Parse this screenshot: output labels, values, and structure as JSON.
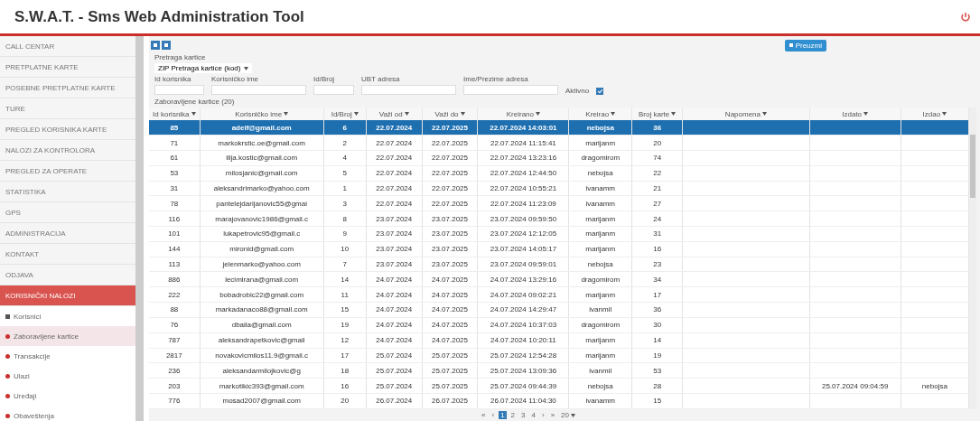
{
  "header": {
    "title": "S.W.A.T. - Sms Web Administration Tool"
  },
  "sidebar": {
    "items": [
      {
        "label": "CALL CENTAR",
        "selected": false
      },
      {
        "label": "PRETPLATNE KARTE",
        "selected": false
      },
      {
        "label": "POSEBNE PRETPLATNE KARTE",
        "selected": false
      },
      {
        "label": "TURE",
        "selected": false
      },
      {
        "label": "PREGLED KORISNIKA KARTE",
        "selected": false
      },
      {
        "label": "NALOZI ZA KONTROLORA",
        "selected": false
      },
      {
        "label": "PREGLED ZA OPERATE",
        "selected": false
      },
      {
        "label": "STATISTIKA",
        "selected": false
      },
      {
        "label": "GPS",
        "selected": false
      },
      {
        "label": "ADMINISTRACIJA",
        "selected": false
      },
      {
        "label": "KONTAKT",
        "selected": false
      },
      {
        "label": "ODJAVA",
        "selected": false
      },
      {
        "label": "KORISNIČKI NALOZI",
        "selected": true,
        "expanded": true,
        "children": [
          {
            "label": "Korisnici",
            "selected": false,
            "kind": "square"
          },
          {
            "label": "Zaboravljene kartice",
            "selected": true,
            "kind": "dot"
          },
          {
            "label": "Transakcije",
            "selected": false,
            "kind": "dot"
          },
          {
            "label": "Ulazi",
            "selected": false,
            "kind": "dot"
          },
          {
            "label": "Uređaji",
            "selected": false,
            "kind": "dot"
          },
          {
            "label": "Obaveštenja",
            "selected": false,
            "kind": "dot"
          }
        ]
      }
    ]
  },
  "toolbar": {
    "export_button": "Preuzmi"
  },
  "filters": {
    "search_label": "Pretraga kartice",
    "search_select": "ZIP Pretraga kartice (kod)",
    "fields": [
      "Id korisnika",
      "Korisničko ime",
      "Id/Broj",
      "UBT adresa",
      "Ime/Prezime adresa"
    ],
    "active": {
      "label": "Aktivno",
      "checked": true
    }
  },
  "table": {
    "caption": "Zaboravljene kartice (20)",
    "columns": [
      "Id korisnika",
      "Korisničko ime",
      "Id/Broj",
      "Važi od",
      "Važi do",
      "Kreirano",
      "Kreirao",
      "Broj karte",
      "Napomena",
      "Izdato",
      "Izdao"
    ],
    "rows": [
      {
        "selected": true,
        "cells": [
          "85",
          "adelf@gmail.com",
          "6",
          "22.07.2024",
          "22.07.2025",
          "22.07.2024 14:03:01",
          "nebojsa",
          "36",
          "",
          "",
          ""
        ]
      },
      {
        "selected": false,
        "cells": [
          "71",
          "markokrstic.oe@gmail.com",
          "2",
          "22.07.2024",
          "22.07.2025",
          "22.07.2024 11:15:41",
          "marijanm",
          "20",
          "",
          "",
          ""
        ]
      },
      {
        "selected": false,
        "cells": [
          "61",
          "ilija.kostic@gmail.com",
          "4",
          "22.07.2024",
          "22.07.2025",
          "22.07.2024 13:23:16",
          "dragomirom",
          "74",
          "",
          "",
          ""
        ]
      },
      {
        "selected": false,
        "cells": [
          "53",
          "milosjanic@gmail.com",
          "5",
          "22.07.2024",
          "22.07.2025",
          "22.07.2024 12:44:50",
          "nebojsa",
          "22",
          "",
          "",
          ""
        ]
      },
      {
        "selected": false,
        "cells": [
          "31",
          "aleksandrimarko@yahoo.com",
          "1",
          "22.07.2024",
          "22.07.2025",
          "22.07.2024 10:55:21",
          "ivanamm",
          "21",
          "",
          "",
          ""
        ]
      },
      {
        "selected": false,
        "cells": [
          "78",
          "pantelejdarijanovic55@gmai",
          "3",
          "22.07.2024",
          "22.07.2025",
          "22.07.2024 11:23:09",
          "ivanamm",
          "27",
          "",
          "",
          ""
        ]
      },
      {
        "selected": false,
        "cells": [
          "116",
          "marajovanovic1986@gmail.c",
          "8",
          "23.07.2024",
          "23.07.2025",
          "23.07.2024 09:59:50",
          "marijanm",
          "24",
          "",
          "",
          ""
        ]
      },
      {
        "selected": false,
        "cells": [
          "101",
          "lukapetrovic95@gmail.c",
          "9",
          "23.07.2024",
          "23.07.2025",
          "23.07.2024 12:12:05",
          "marijanm",
          "31",
          "",
          "",
          ""
        ]
      },
      {
        "selected": false,
        "cells": [
          "144",
          "mironid@gmail.com",
          "10",
          "23.07.2024",
          "23.07.2025",
          "23.07.2024 14:05:17",
          "marijanm",
          "16",
          "",
          "",
          ""
        ]
      },
      {
        "selected": false,
        "cells": [
          "113",
          "jelenmarko@yahoo.com",
          "7",
          "23.07.2024",
          "23.07.2025",
          "23.07.2024 09:59:01",
          "nebojsa",
          "23",
          "",
          "",
          ""
        ]
      },
      {
        "selected": false,
        "cells": [
          "886",
          "lecimirana@gmail.com",
          "14",
          "24.07.2024",
          "24.07.2025",
          "24.07.2024 13:29:16",
          "dragomirom",
          "34",
          "",
          "",
          ""
        ]
      },
      {
        "selected": false,
        "cells": [
          "222",
          "bobadrobic22@gmail.com",
          "11",
          "24.07.2024",
          "24.07.2025",
          "24.07.2024 09:02:21",
          "marijanm",
          "17",
          "",
          "",
          ""
        ]
      },
      {
        "selected": false,
        "cells": [
          "88",
          "markadanaco88@gmail.com",
          "15",
          "24.07.2024",
          "24.07.2025",
          "24.07.2024 14:29:47",
          "ivanmil",
          "36",
          "",
          "",
          ""
        ]
      },
      {
        "selected": false,
        "cells": [
          "76",
          "dbaila@gmail.com",
          "19",
          "24.07.2024",
          "24.07.2025",
          "24.07.2024 10:37:03",
          "dragomirom",
          "30",
          "",
          "",
          ""
        ]
      },
      {
        "selected": false,
        "cells": [
          "787",
          "aleksandrapetkovic@gmail",
          "12",
          "24.07.2024",
          "24.07.2025",
          "24.07.2024 10:20:11",
          "marijanm",
          "14",
          "",
          "",
          ""
        ]
      },
      {
        "selected": false,
        "cells": [
          "2817",
          "novakovicmilos11.9@gmail.c",
          "17",
          "25.07.2024",
          "25.07.2025",
          "25.07.2024 12:54:28",
          "marijanm",
          "19",
          "",
          "",
          ""
        ]
      },
      {
        "selected": false,
        "cells": [
          "236",
          "aleksandarmilojkovic@g",
          "18",
          "25.07.2024",
          "25.07.2025",
          "25.07.2024 13:09:36",
          "ivanmil",
          "53",
          "",
          "",
          ""
        ]
      },
      {
        "selected": false,
        "cells": [
          "203",
          "markotikic393@gmail.com",
          "16",
          "25.07.2024",
          "25.07.2025",
          "25.07.2024 09:44:39",
          "nebojsa",
          "28",
          "",
          "25.07.2024 09:04:59",
          "nebojsa"
        ]
      },
      {
        "selected": false,
        "cells": [
          "776",
          "mosad2007@gmail.com",
          "20",
          "26.07.2024",
          "26.07.2025",
          "26.07.2024 11:04:30",
          "ivanamm",
          "15",
          "",
          "",
          ""
        ]
      }
    ]
  },
  "pagination": {
    "first": "«",
    "prev": "‹",
    "next": "›",
    "last": "»",
    "pages": [
      {
        "label": "1",
        "selected": true
      },
      {
        "label": "2",
        "selected": false
      },
      {
        "label": "3",
        "selected": false
      },
      {
        "label": "4",
        "selected": false
      }
    ],
    "page_size": "20"
  }
}
